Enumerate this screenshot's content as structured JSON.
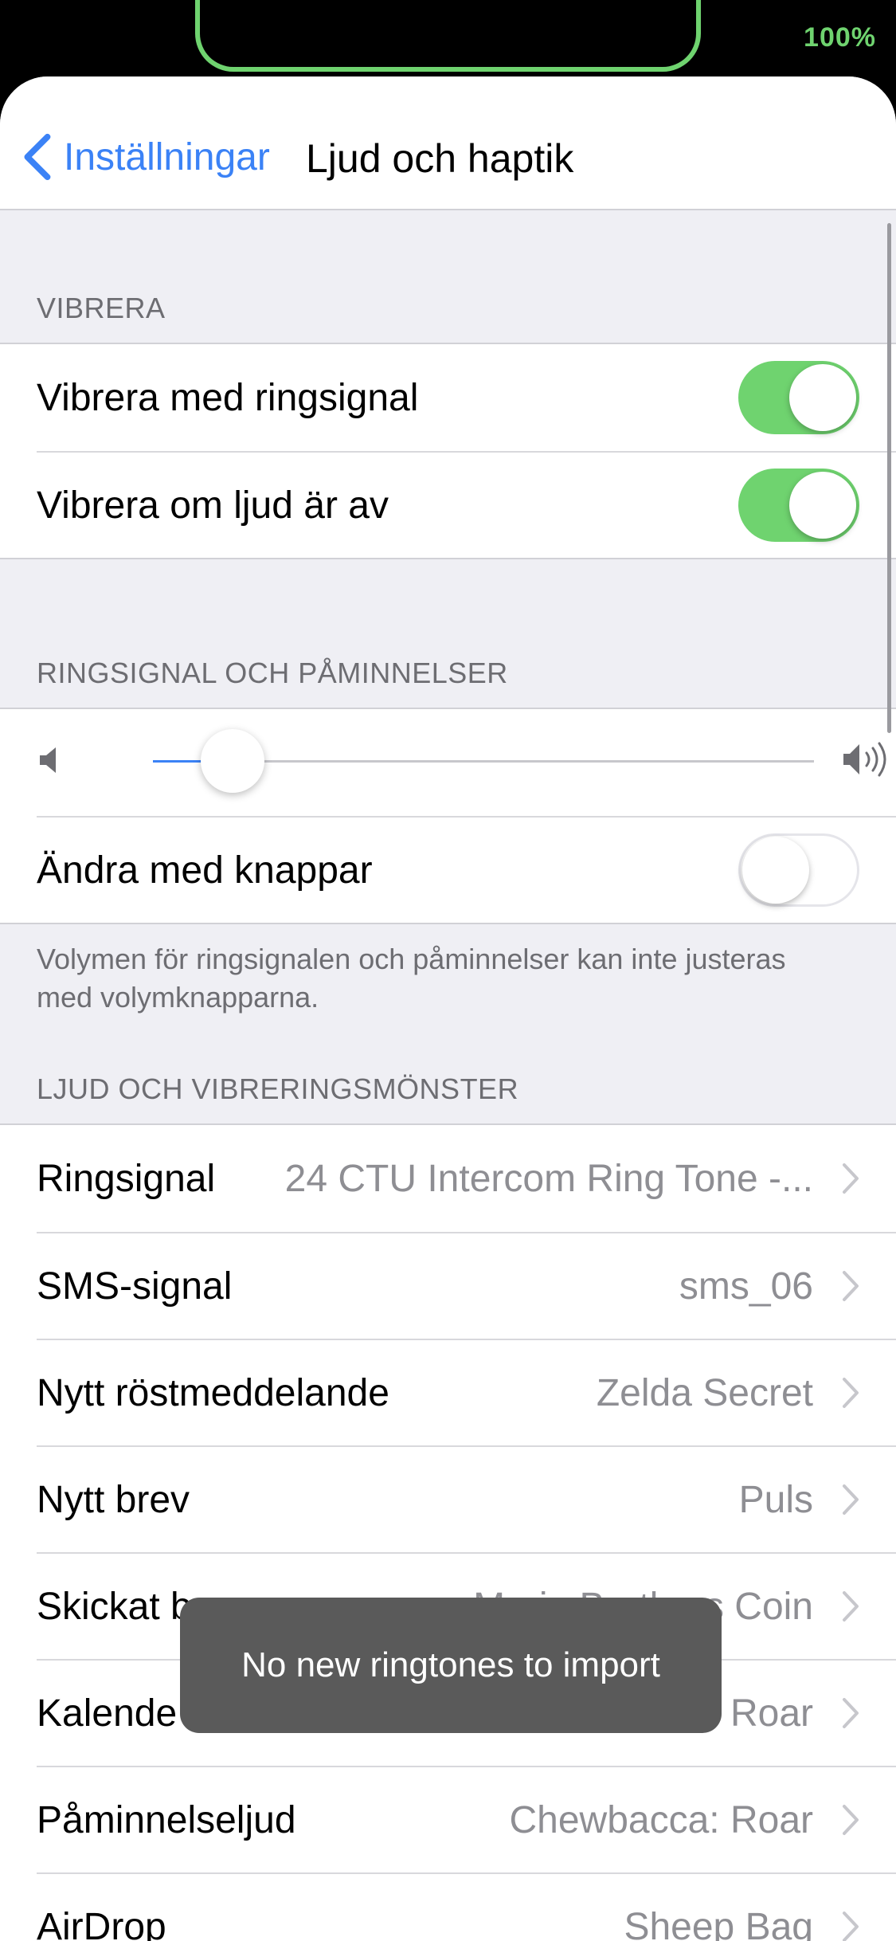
{
  "status_bar": {
    "battery": "100%"
  },
  "nav": {
    "back_label": "Inställningar",
    "title": "Ljud och haptik"
  },
  "vibrate": {
    "header": "VIBRERA",
    "rows": [
      {
        "label": "Vibrera med ringsignal",
        "on": true
      },
      {
        "label": "Vibrera om ljud är av",
        "on": true
      }
    ]
  },
  "ringer": {
    "header": "RINGSIGNAL OCH PÅMINNELSER",
    "volume_level": 0.12,
    "change_with_buttons": {
      "label": "Ändra med knappar",
      "on": false
    },
    "footer": "Volymen för ringsignalen och påminnelser kan inte justeras med volymknapparna."
  },
  "sounds": {
    "header": "LJUD OCH VIBRERINGSMÖNSTER",
    "rows": [
      {
        "label": "Ringsignal",
        "value": "24 CTU Intercom Ring Tone -..."
      },
      {
        "label": "SMS-signal",
        "value": "sms_06"
      },
      {
        "label": "Nytt röstmeddelande",
        "value": "Zelda Secret"
      },
      {
        "label": "Nytt brev",
        "value": "Puls"
      },
      {
        "label": "Skickat brev",
        "value": "Mario Brothers Coin"
      },
      {
        "label": "Kalende",
        "value": "Roar"
      },
      {
        "label": "Påminnelseljud",
        "value": "Chewbacca: Roar"
      },
      {
        "label": "AirDrop",
        "value": "Sheep Bag"
      }
    ]
  },
  "toast": {
    "message": "No new ringtones to import"
  },
  "colors": {
    "accent": "#3b82f6",
    "toggle_on": "#6fd36f",
    "background": "#efeff4"
  }
}
